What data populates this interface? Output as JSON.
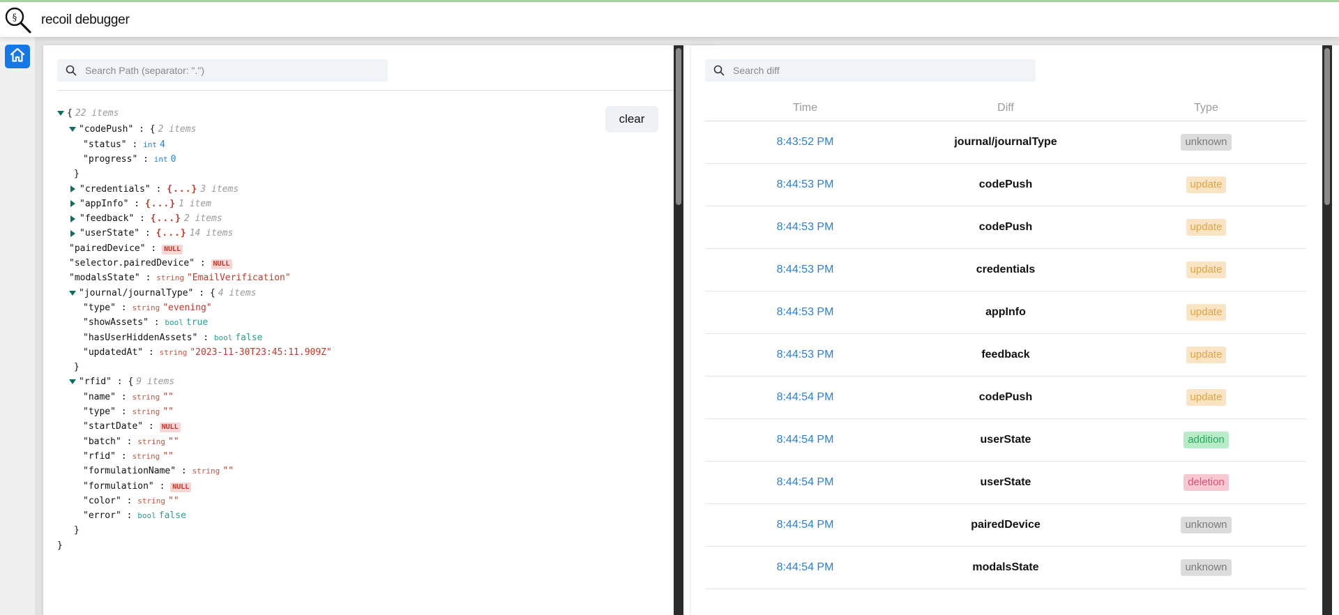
{
  "app": {
    "title": "recoil debugger",
    "logo_icon": "magnifier-icon"
  },
  "nav": {
    "home_icon": "home-icon"
  },
  "state_panel": {
    "search_placeholder": "Search Path (separator: \".\")",
    "search_value": "",
    "clear_label": "clear",
    "root": {
      "brace": "{",
      "meta": "22 items",
      "close": "}"
    },
    "tree": [
      {
        "indent": 1,
        "caret": "down",
        "key": "\"codePush\"",
        "sep": " : ",
        "brace": "{",
        "meta": "2 items"
      },
      {
        "indent": 2,
        "key": "\"status\"",
        "sep": " : ",
        "type": "int",
        "value": "4",
        "vclass": "int"
      },
      {
        "indent": 2,
        "key": "\"progress\"",
        "sep": " : ",
        "type": "int",
        "value": "0",
        "vclass": "int"
      },
      {
        "indent": 1,
        "close": "}"
      },
      {
        "indent": 1,
        "caret": "right",
        "key": "\"credentials\"",
        "sep": " : ",
        "collapsed": "{...}",
        "meta": "3 items"
      },
      {
        "indent": 1,
        "caret": "right",
        "key": "\"appInfo\"",
        "sep": " : ",
        "collapsed": "{...}",
        "meta": "1 item"
      },
      {
        "indent": 1,
        "caret": "right",
        "key": "\"feedback\"",
        "sep": " : ",
        "collapsed": "{...}",
        "meta": "2 items"
      },
      {
        "indent": 1,
        "caret": "right",
        "key": "\"userState\"",
        "sep": " : ",
        "collapsed": "{...}",
        "meta": "14 items"
      },
      {
        "indent": 1,
        "key": "\"pairedDevice\"",
        "sep": " : ",
        "null": "NULL"
      },
      {
        "indent": 1,
        "key": "\"selector.pairedDevice\"",
        "sep": " : ",
        "null": "NULL"
      },
      {
        "indent": 1,
        "key": "\"modalsState\"",
        "sep": " : ",
        "type": "string",
        "value": "\"EmailVerification\"",
        "vclass": "string"
      },
      {
        "indent": 1,
        "caret": "down",
        "key": "\"journal/journalType\"",
        "sep": " : ",
        "brace": "{",
        "meta": "4 items"
      },
      {
        "indent": 2,
        "key": "\"type\"",
        "sep": " : ",
        "type": "string",
        "value": "\"evening\"",
        "vclass": "string"
      },
      {
        "indent": 2,
        "key": "\"showAssets\"",
        "sep": " : ",
        "type": "bool",
        "value": "true",
        "vclass": "bool"
      },
      {
        "indent": 2,
        "key": "\"hasUserHiddenAssets\"",
        "sep": " : ",
        "type": "bool",
        "value": "false",
        "vclass": "bool"
      },
      {
        "indent": 2,
        "key": "\"updatedAt\"",
        "sep": " : ",
        "type": "string",
        "value": "\"2023-11-30T23:45:11.909Z\"",
        "vclass": "string"
      },
      {
        "indent": 1,
        "close": "}"
      },
      {
        "indent": 1,
        "caret": "down",
        "key": "\"rfid\"",
        "sep": " : ",
        "brace": "{",
        "meta": "9 items"
      },
      {
        "indent": 2,
        "key": "\"name\"",
        "sep": " : ",
        "type": "string",
        "value": "\"\"",
        "vclass": "string"
      },
      {
        "indent": 2,
        "key": "\"type\"",
        "sep": " : ",
        "type": "string",
        "value": "\"\"",
        "vclass": "string"
      },
      {
        "indent": 2,
        "key": "\"startDate\"",
        "sep": " : ",
        "null": "NULL"
      },
      {
        "indent": 2,
        "key": "\"batch\"",
        "sep": " : ",
        "type": "string",
        "value": "\"\"",
        "vclass": "string"
      },
      {
        "indent": 2,
        "key": "\"rfid\"",
        "sep": " : ",
        "type": "string",
        "value": "\"\"",
        "vclass": "string"
      },
      {
        "indent": 2,
        "key": "\"formulationName\"",
        "sep": " : ",
        "type": "string",
        "value": "\"\"",
        "vclass": "string"
      },
      {
        "indent": 2,
        "key": "\"formulation\"",
        "sep": " : ",
        "null": "NULL"
      },
      {
        "indent": 2,
        "key": "\"color\"",
        "sep": " : ",
        "type": "string",
        "value": "\"\"",
        "vclass": "string"
      },
      {
        "indent": 2,
        "key": "\"error\"",
        "sep": " : ",
        "type": "bool",
        "value": "false",
        "vclass": "bool"
      },
      {
        "indent": 1,
        "close": "}"
      }
    ]
  },
  "diff_panel": {
    "search_placeholder": "Search diff",
    "search_value": "",
    "columns": {
      "time": "Time",
      "diff": "Diff",
      "type": "Type"
    },
    "rows": [
      {
        "time": "8:43:52 PM",
        "diff": "journal/journalType",
        "type": "unknown"
      },
      {
        "time": "8:44:53 PM",
        "diff": "codePush",
        "type": "update"
      },
      {
        "time": "8:44:53 PM",
        "diff": "codePush",
        "type": "update"
      },
      {
        "time": "8:44:53 PM",
        "diff": "credentials",
        "type": "update"
      },
      {
        "time": "8:44:53 PM",
        "diff": "appInfo",
        "type": "update"
      },
      {
        "time": "8:44:53 PM",
        "diff": "feedback",
        "type": "update"
      },
      {
        "time": "8:44:54 PM",
        "diff": "codePush",
        "type": "update"
      },
      {
        "time": "8:44:54 PM",
        "diff": "userState",
        "type": "addition"
      },
      {
        "time": "8:44:54 PM",
        "diff": "userState",
        "type": "deletion"
      },
      {
        "time": "8:44:54 PM",
        "diff": "pairedDevice",
        "type": "unknown"
      },
      {
        "time": "8:44:54 PM",
        "diff": "modalsState",
        "type": "unknown"
      }
    ]
  },
  "colors": {
    "accent": "#1677e6",
    "top_bar": "#a8d5a2",
    "time_text": "#2a7fd4",
    "unknown_bg": "#dcdcdc",
    "update_bg": "#f9e4c3",
    "addition_bg": "#b8ecc8",
    "deletion_bg": "#f7c8d2"
  }
}
